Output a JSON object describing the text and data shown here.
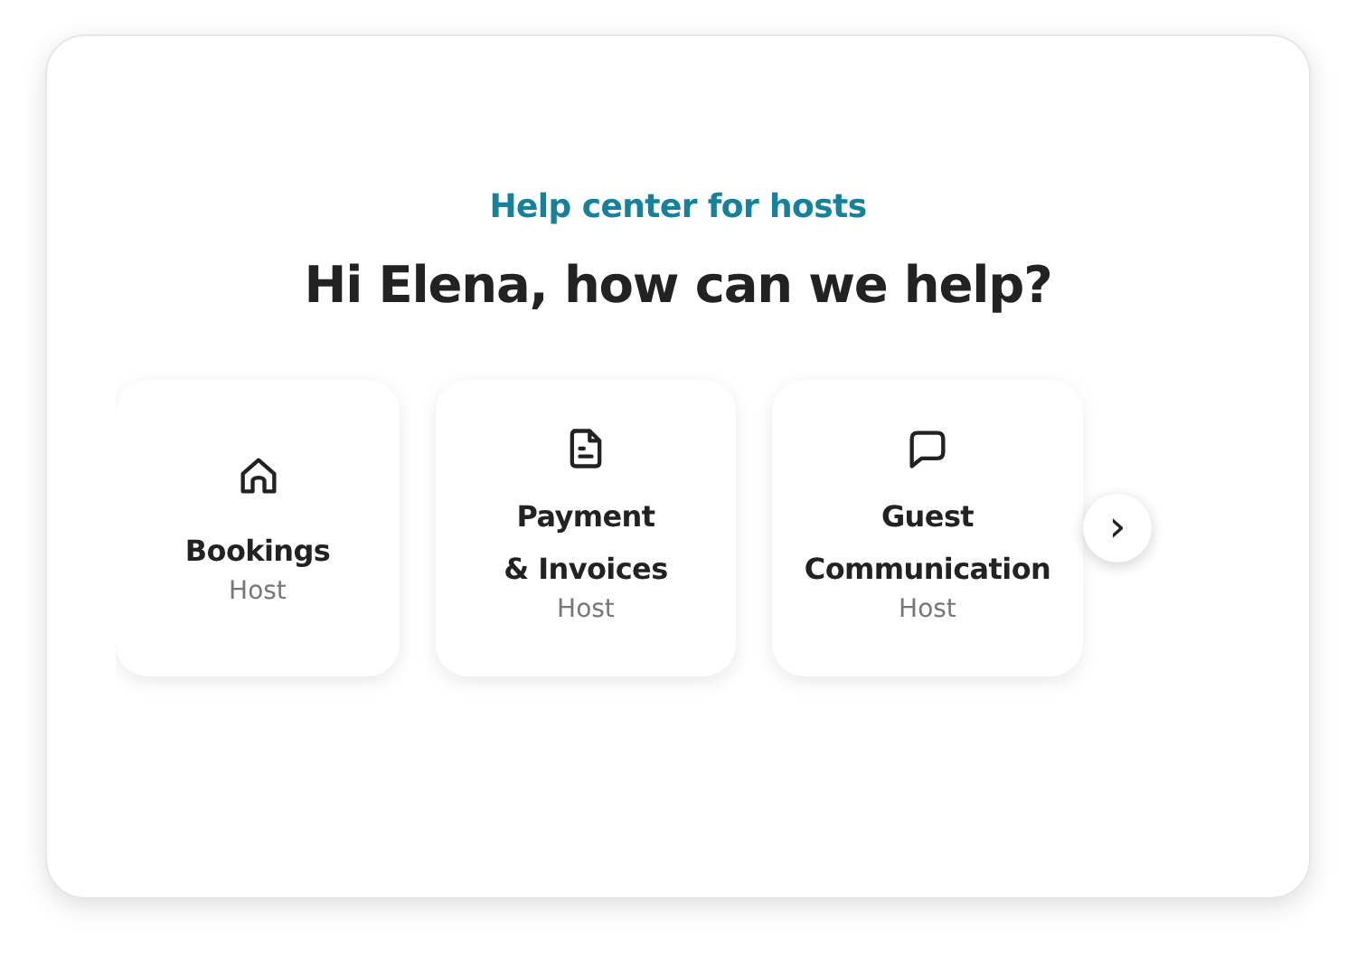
{
  "eyebrow": "Help center for hosts",
  "heading": "Hi Elena, how can we help?",
  "topics": [
    {
      "title": "Bookings",
      "subtitle": "Host"
    },
    {
      "title": "Payment\n& Invoices",
      "subtitle": "Host"
    },
    {
      "title": "Guest Communication",
      "subtitle": "Host"
    }
  ],
  "next_button": {
    "label": "›"
  }
}
